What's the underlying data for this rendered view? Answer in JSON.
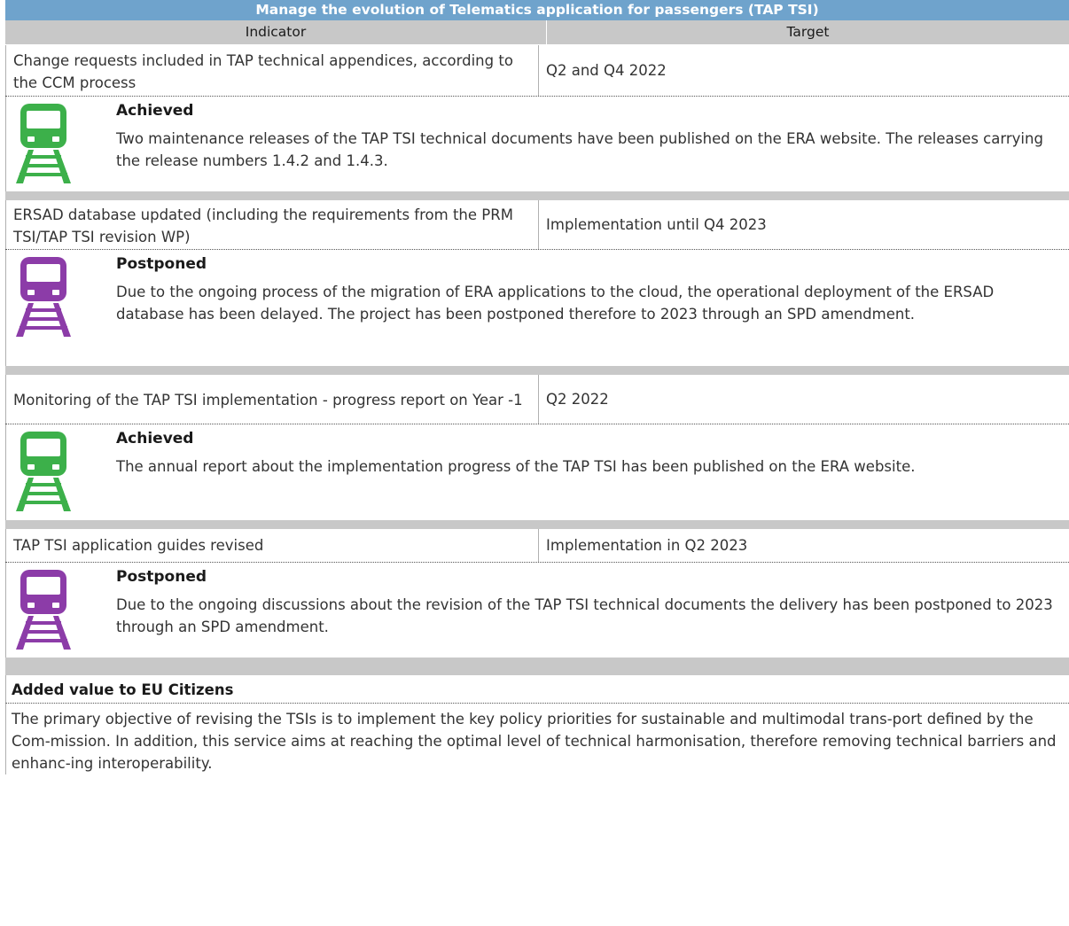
{
  "title": "Manage the evolution of Telematics application for passengers (TAP TSI)",
  "columns": {
    "indicator": "Indicator",
    "target": "Target"
  },
  "colors": {
    "achieved": "#3cb04a",
    "postponed": "#8c3ca8",
    "header_bg": "#6fa3cc",
    "separator": "#c8c8c8"
  },
  "rows": [
    {
      "indicator": "Change requests included in TAP technical appendices, according to the CCM process",
      "target": "Q2 and Q4 2022",
      "status_icon": "train-icon",
      "status": "Achieved",
      "description": "Two maintenance releases of the TAP TSI technical documents have been published on the ERA website. The releases carrying the release numbers 1.4.2 and 1.4.3."
    },
    {
      "indicator": "ERSAD database updated (including the requirements from the PRM TSI/TAP TSI revision WP)",
      "target": "Implementation until Q4 2023",
      "status_icon": "train-icon",
      "status": "Postponed",
      "description": "Due to the ongoing process of the migration of ERA applications to the cloud, the operational deployment of the ERSAD database has been delayed. The project has been postponed therefore to 2023 through an SPD amendment."
    },
    {
      "indicator": "Monitoring of the TAP TSI implementation - progress report on Year -1",
      "target": "Q2 2022",
      "status_icon": "train-icon",
      "status": "Achieved",
      "description": "The annual report about the implementation progress of the TAP TSI has been published on the ERA website."
    },
    {
      "indicator": "TAP TSI application guides revised",
      "target": "Implementation in Q2 2023",
      "status_icon": "train-icon",
      "status": "Postponed",
      "description": "Due to the ongoing discussions about the revision of the TAP TSI technical documents the delivery has been postponed to 2023 through an SPD amendment."
    }
  ],
  "added_value": {
    "heading": "Added value to EU Citizens",
    "text": "The primary objective of revising the TSIs is to implement the key policy priorities for sustainable and multimodal trans-port defined by the Com-mission. In addition, this service aims at reaching the optimal level of technical harmonisation, therefore removing technical barriers and enhanc-ing interoperability."
  }
}
